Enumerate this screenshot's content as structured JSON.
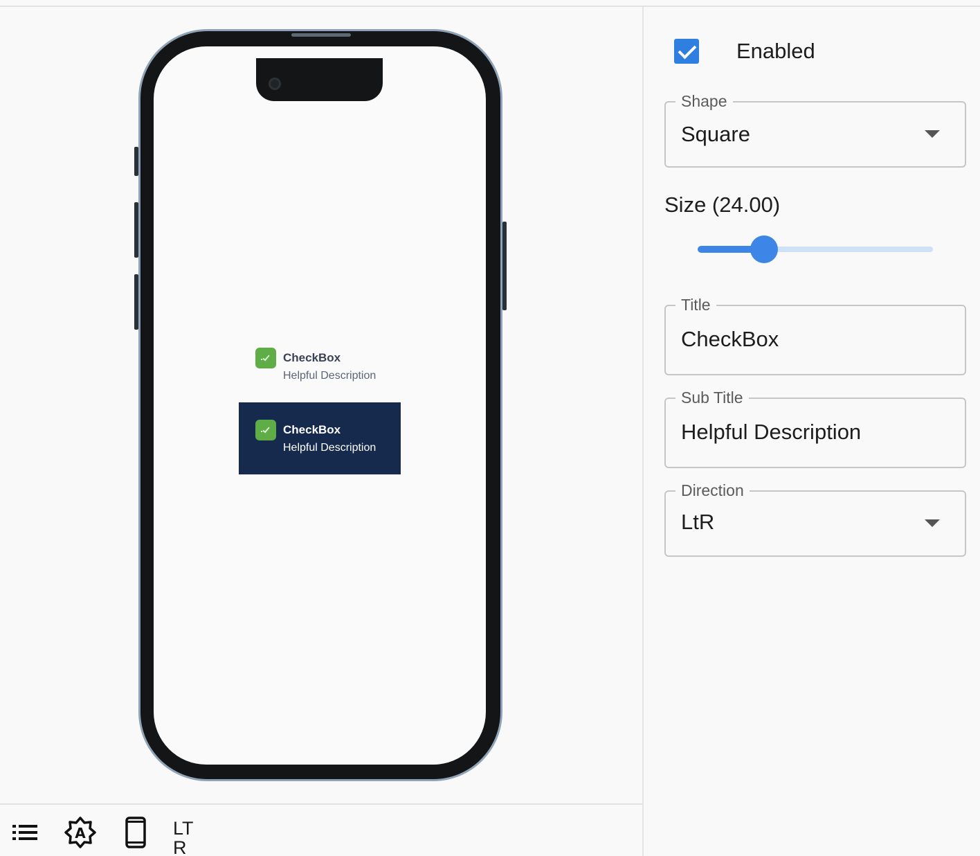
{
  "preview": {
    "items": [
      {
        "title": "CheckBox",
        "subtitle": "Helpful Description"
      },
      {
        "title": "CheckBox",
        "subtitle": "Helpful Description"
      }
    ]
  },
  "toolbar": {
    "list_icon": "list-icon",
    "theme_icon": "brightness-auto-icon",
    "device_icon": "smartphone-icon",
    "direction_text": "LTR"
  },
  "controls": {
    "enabled_label": "Enabled",
    "enabled_checked": true,
    "shape": {
      "label": "Shape",
      "value": "Square"
    },
    "size": {
      "label": "Size (24.00)",
      "value": 24.0
    },
    "title": {
      "label": "Title",
      "value": "CheckBox"
    },
    "subtitle": {
      "label": "Sub Title",
      "value": "Helpful Description"
    },
    "direction": {
      "label": "Direction",
      "value": "LtR"
    }
  },
  "colors": {
    "accent": "#3d86e8",
    "checkbox_green": "#5ead46",
    "dark_panel": "#152a4d"
  }
}
